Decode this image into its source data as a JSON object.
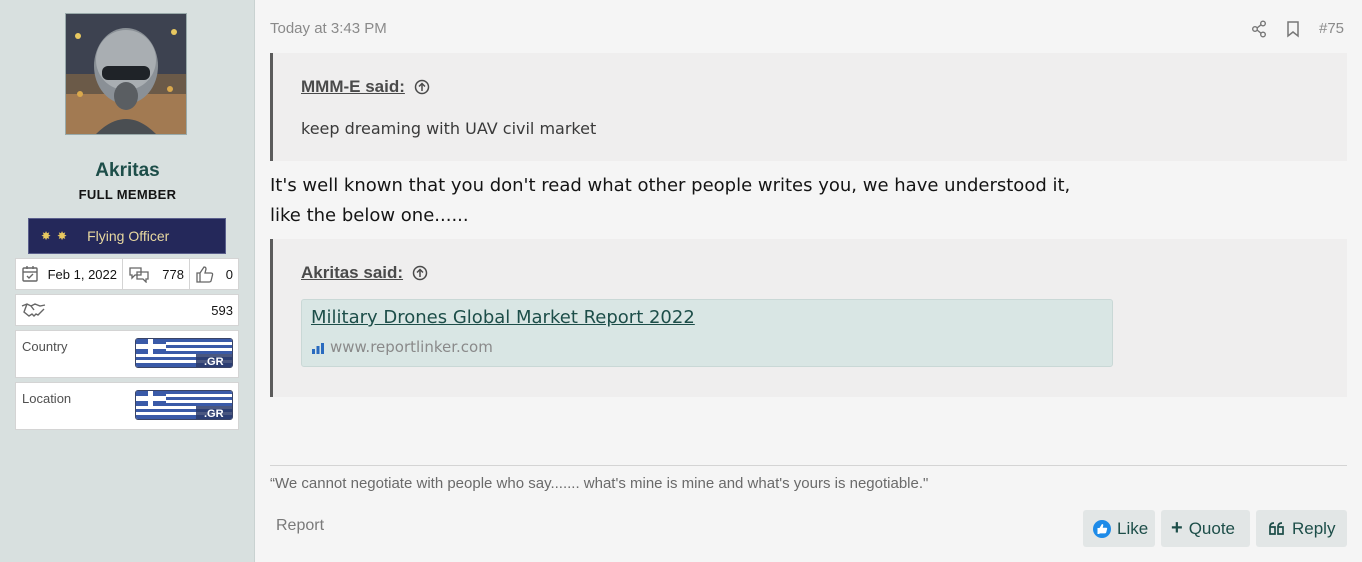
{
  "user": {
    "name": "Akritas",
    "title": "FULL MEMBER",
    "rank_banner": "Flying Officer",
    "joined": "Feb 1, 2022",
    "messages": "778",
    "reactions": "0",
    "points": "593",
    "country_label": "Country",
    "location_label": "Location",
    "flag_text": ".GR"
  },
  "post": {
    "date": "Today at 3:43 PM",
    "number": "#75",
    "quote1": {
      "author": "MMM-E said:",
      "text": "keep dreaming with UAV civil market"
    },
    "message_line1": "It's well known that you don't read what other people writes you, we have understood it,",
    "message_line2": "like the below one......",
    "quote2": {
      "author": "Akritas said:",
      "link_title": "Military Drones Global Market Report 2022",
      "link_site": "www.reportlinker.com"
    },
    "signature": "“We cannot negotiate with people who say....... what's mine is mine and what's yours is negotiable.\"",
    "report_label": "Report",
    "like_label": "Like",
    "quote_label": "Quote",
    "reply_label": "Reply"
  },
  "colors": {
    "sidebar_bg": "#d8e0df",
    "accent": "#1d4e49",
    "quote_bg": "#efeeee",
    "unfurl_bg": "#d9e6e4"
  }
}
